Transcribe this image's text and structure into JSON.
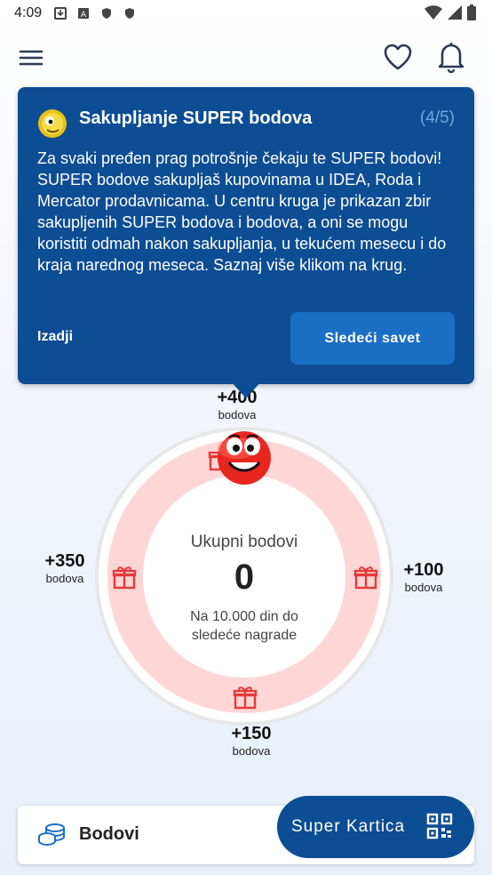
{
  "status_bar": {
    "time": "4:09"
  },
  "tooltip": {
    "title": "Sakupljanje SUPER bodova",
    "step": "(4/5)",
    "body": "Za svaki pređen prag potrošnje čekaju te SUPER bodovi! SUPER bodove sakupljaš kupovinama u IDEA, Roda i Mercator prodavnicama. U centru kruga je prikazan zbir sakupljenih SUPER bodova i bodova, a oni se mogu koristiti odmah nakon sakupljanja, u tekućem mesecu i do kraja narednog meseca. Saznaj više klikom na krug.",
    "exit_label": "Izadji",
    "next_label": "Sledeći savet"
  },
  "ring": {
    "total_label": "Ukupni bodovi",
    "total_value": "0",
    "subtext": "Na 10.000 din do sledeće nagrade",
    "points_top": {
      "value": "+400",
      "unit": "bodova"
    },
    "points_right": {
      "value": "+100",
      "unit": "bodova"
    },
    "points_bottom": {
      "value": "+150",
      "unit": "bodova"
    },
    "points_left": {
      "value": "+350",
      "unit": "bodova"
    }
  },
  "bottom": {
    "bodovi_label": "Bodovi",
    "super_card_label": "Super Kartica"
  },
  "colors": {
    "primary": "#0d4d94",
    "button": "#1a6fc4",
    "ring": "#ffd6d6",
    "gift": "#e43a3a"
  },
  "icons": [
    "menu-icon",
    "heart-icon",
    "bell-icon",
    "coins-icon",
    "qr-code-icon",
    "gift-icon"
  ]
}
